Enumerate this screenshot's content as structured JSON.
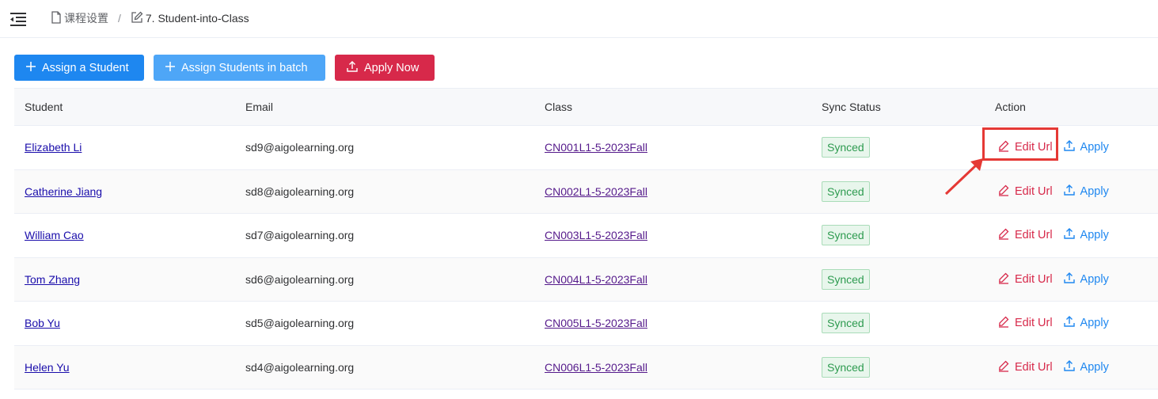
{
  "header": {
    "menu_toggle_icon": "menu-fold-icon",
    "breadcrumb": {
      "items": [
        {
          "label": "课程设置",
          "icon": "file-icon"
        },
        {
          "label": "7. Student-into-Class",
          "icon": "edit-icon"
        }
      ],
      "separator": "/"
    }
  },
  "toolbar": {
    "assign_student_label": "Assign a Student",
    "assign_batch_label": "Assign Students in batch",
    "apply_now_label": "Apply Now"
  },
  "table": {
    "columns": [
      "Student",
      "Email",
      "Class",
      "Sync Status",
      "Action"
    ],
    "actions": {
      "edit_label": "Edit Url",
      "apply_label": "Apply"
    },
    "rows": [
      {
        "student": "Elizabeth Li",
        "email": "sd9@aigolearning.org",
        "class": "CN001L1-5-2023Fall",
        "status": "Synced"
      },
      {
        "student": "Catherine Jiang",
        "email": "sd8@aigolearning.org",
        "class": "CN002L1-5-2023Fall",
        "status": "Synced"
      },
      {
        "student": "William Cao",
        "email": "sd7@aigolearning.org",
        "class": "CN003L1-5-2023Fall",
        "status": "Synced"
      },
      {
        "student": "Tom Zhang",
        "email": "sd6@aigolearning.org",
        "class": "CN004L1-5-2023Fall",
        "status": "Synced"
      },
      {
        "student": "Bob Yu",
        "email": "sd5@aigolearning.org",
        "class": "CN005L1-5-2023Fall",
        "status": "Synced"
      },
      {
        "student": "Helen Yu",
        "email": "sd4@aigolearning.org",
        "class": "CN006L1-5-2023Fall",
        "status": "Synced"
      }
    ]
  },
  "colors": {
    "primary": "#1e87f0",
    "primary_light": "#4ea6f7",
    "danger": "#d7294a",
    "success": "#2e9b50",
    "annotation": "#e53935"
  }
}
